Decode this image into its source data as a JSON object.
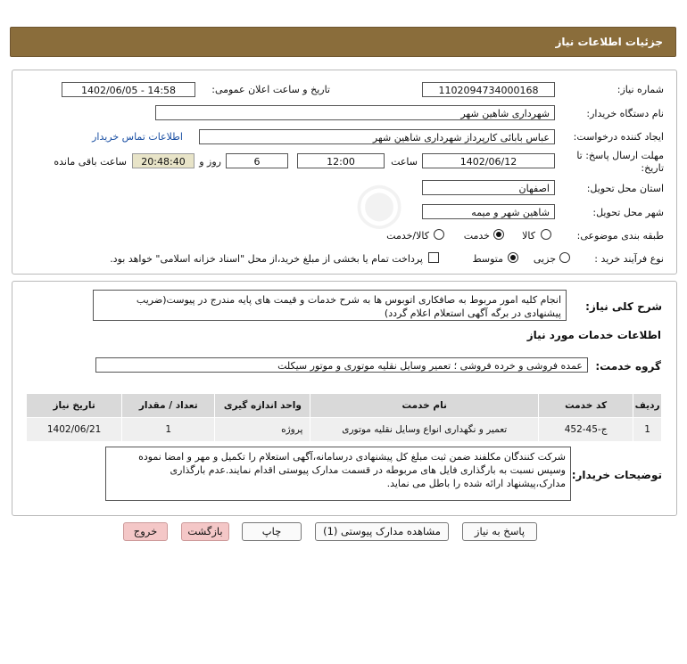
{
  "header": {
    "title": "جزئیات اطلاعات نیاز"
  },
  "details": {
    "need_number_label": "شماره نیاز:",
    "need_number": "1102094734000168",
    "announce_label": "تاریخ و ساعت اعلان عمومی:",
    "announce_value": "1402/06/05 - 14:58",
    "buyer_org_label": "نام دستگاه خریدار:",
    "buyer_org": "شهرداری شاهین شهر",
    "creator_label": "ایجاد کننده درخواست:",
    "creator": "عباس بابائی کارپرداز شهرداری شاهین شهر",
    "contact_link": "اطلاعات تماس خریدار",
    "deadline_label_1": "مهلت ارسال پاسخ: تا",
    "deadline_label_2": "تاریخ:",
    "deadline_date": "1402/06/12",
    "time_label": "ساعت",
    "deadline_time": "12:00",
    "days_value": "6",
    "days_label": "روز و",
    "remaining_time": "20:48:40",
    "remaining_label": "ساعت باقی مانده",
    "province_label": "استان محل تحویل:",
    "province": "اصفهان",
    "city_label": "شهر محل تحویل:",
    "city": "شاهین شهر و میمه",
    "category_label": "طبقه بندی موضوعی:",
    "category_options": [
      "کالا",
      "خدمت",
      "کالا/خدمت"
    ],
    "category_selected": "خدمت",
    "process_label": "نوع فرآیند خرید :",
    "process_options": [
      "جزیی",
      "متوسط"
    ],
    "process_selected": "متوسط",
    "payment_note": "پرداخت تمام یا بخشی از مبلغ خرید،از محل \"اسناد خزانه اسلامی\" خواهد بود."
  },
  "summary": {
    "label": "شرح کلی نیاز:",
    "text": "انجام کلیه امور مربوط به صافکاری اتوبوس ها به شرح خدمات و قیمت های پایه مندرج در پیوست(ضریب پیشنهادی در برگه آگهی استعلام اعلام گردد)"
  },
  "services": {
    "section_title": "اطلاعات خدمات مورد نیاز",
    "group_label": "گروه خدمت:",
    "group_value": "عمده فروشی و خرده فروشی ؛ تعمیر وسایل نقلیه موتوری و موتور سیکلت",
    "columns": [
      "ردیف",
      "کد خدمت",
      "نام خدمت",
      "واحد اندازه گیری",
      "تعداد / مقدار",
      "تاریخ نیاز"
    ],
    "rows": [
      {
        "row": "1",
        "code": "ج-45-452",
        "name": "تعمیر و نگهداری انواع وسایل نقلیه موتوری",
        "unit": "پروژه",
        "qty": "1",
        "date": "1402/06/21"
      }
    ]
  },
  "buyer_notes": {
    "label": "توضیحات خریدار:",
    "text": "شرکت کنندگان مکلفند ضمن ثبت مبلغ کل پیشنهادی درسامانه،آگهی استعلام را  تکمیل و مهر و امضا نموده وسپس نسبت به بارگذاری فایل های مربوطه در قسمت مدارک پیوستی اقدام نمایند.عدم بارگذاری مدارک،پیشنهاد ارائه شده را باطل می نماید."
  },
  "buttons": {
    "reply": "پاسخ به نیاز",
    "attachments": "مشاهده مدارک پیوستی (1)",
    "print": "چاپ",
    "back": "بازگشت",
    "exit": "خروج"
  }
}
